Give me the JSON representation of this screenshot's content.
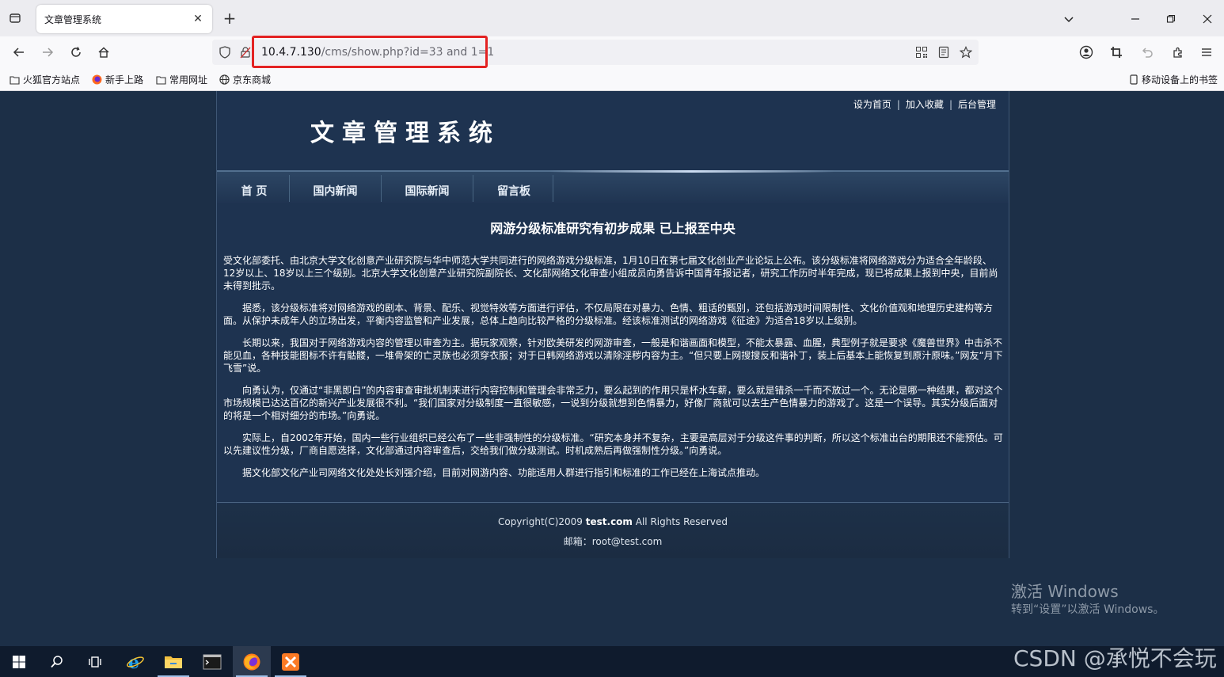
{
  "browser": {
    "tab_title": "文章管理系统",
    "url_host": "10.4.7.130",
    "url_path": "/cms/show.php?id=33 and 1=1",
    "bookmarks": [
      "火狐官方站点",
      "新手上路",
      "常用网址",
      "京东商城"
    ],
    "mobile_bookmarks": "移动设备上的书签"
  },
  "site": {
    "top_links": [
      "设为首页",
      "加入收藏",
      "后台管理"
    ],
    "logo_text": "文章管理系统",
    "menu": [
      "首 页",
      "国内新闻",
      "国际新闻",
      "留言板"
    ]
  },
  "article": {
    "title": "网游分级标准研究有初步成果 已上报至中央",
    "paragraphs": [
      "受文化部委托、由北京大学文化创意产业研究院与华中师范大学共同进行的网络游戏分级标准，1月10日在第七届文化创业产业论坛上公布。该分级标准将网络游戏分为适合全年龄段、12岁以上、18岁以上三个级别。北京大学文化创意产业研究院副院长、文化部网络文化审查小组成员向勇告诉中国青年报记者，研究工作历时半年完成，现已将成果上报到中央，目前尚未得到批示。",
      "据悉，该分级标准将对网络游戏的剧本、背景、配乐、视觉特效等方面进行评估，不仅局限在对暴力、色情、粗话的甄别，还包括游戏时间限制性、文化价值观和地理历史建构等方面。从保护未成年人的立场出发，平衡内容监管和产业发展，总体上趋向比较严格的分级标准。经该标准测试的网络游戏《征途》为适合18岁以上级别。",
      "长期以来，我国对于网络游戏内容的管理以审查为主。据玩家观察，针对欧美研发的网游审查，一般是和谐画面和模型，不能太暴露、血腥，典型例子就是要求《魔兽世界》中击杀不能见血，各种技能图标不许有骷髅，一堆骨架的亡灵族也必须穿衣服；对于日韩网络游戏以清除淫秽内容为主。“但只要上网搜搜反和谐补丁，装上后基本上能恢复到原汁原味。”网友“月下飞雪”说。",
      "向勇认为，仅通过“非黑即白”的内容审查审批机制来进行内容控制和管理会非常乏力，要么起到的作用只是杯水车薪，要么就是错杀一千而不放过一个。无论是哪一种结果，都对这个市场规模已达达百亿的新兴产业发展很不利。“我们国家对分级制度一直很敏感，一说到分级就想到色情暴力，好像厂商就可以去生产色情暴力的游戏了。这是一个误导。其实分级后面对的将是一个相对细分的市场。”向勇说。",
      "实际上，自2002年开始，国内一些行业组织已经公布了一些非强制性的分级标准。“研究本身并不复杂，主要是高层对于分级这件事的判断，所以这个标准出台的期限还不能预估。可以先建议性分级，厂商自愿选择，文化部通过内容审查后，交给我们做分级测试。时机成熟后再做强制性分级。”向勇说。",
      "据文化部文化产业司网络文化处处长刘强介绍，目前对网游内容、功能适用人群进行指引和标准的工作已经在上海试点推动。"
    ]
  },
  "footer": {
    "copyright_prefix": "Copyright(C)2009 ",
    "copyright_domain": "test.com",
    "copyright_suffix": " All Rights Reserved",
    "email_label": "邮箱：",
    "email": "root@test.com"
  },
  "overlay": {
    "activate_title": "激活 Windows",
    "activate_sub": "转到“设置”以激活 Windows。",
    "csdn_watermark": "CSDN @承悦不会玩"
  },
  "colors": {
    "page_bg": "#1c2f47",
    "highlight_box": "#e32222",
    "text": "#ffffff"
  }
}
